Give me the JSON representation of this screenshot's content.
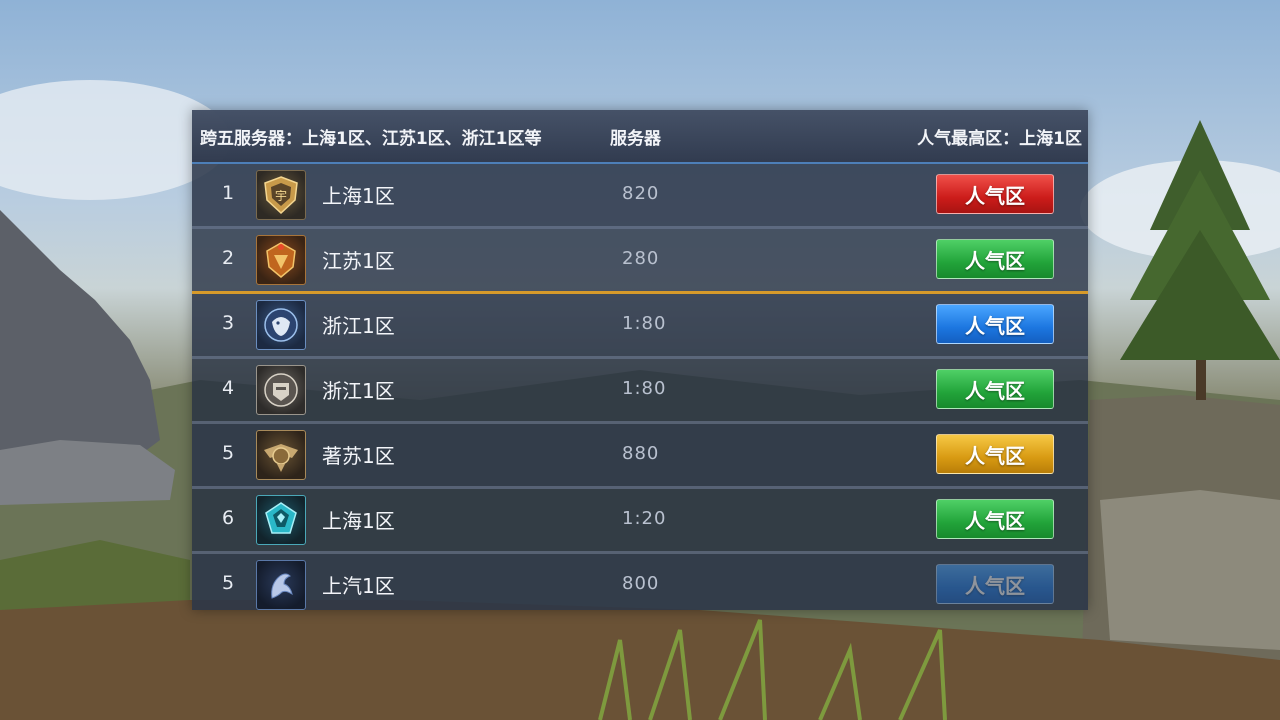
{
  "header": {
    "left": "跨五服务器：上海1区、江苏1区、浙江1区等",
    "middle": "服务器",
    "right": "人气最高区：上海1区"
  },
  "rows": [
    {
      "rank": "1",
      "name": "上海1区",
      "count": "820",
      "button": "人气区",
      "button_color": "#e02a26",
      "emblem": "shield-emblem-icon"
    },
    {
      "rank": "2",
      "name": "江苏1区",
      "count": "280",
      "button": "人气区",
      "button_color": "#22a33a",
      "emblem": "crest-emblem-icon"
    },
    {
      "rank": "3",
      "name": "浙江1区",
      "count": "1:80",
      "button": "人气区",
      "button_color": "#1c76e0",
      "emblem": "wolf-emblem-icon"
    },
    {
      "rank": "4",
      "name": "浙江1区",
      "count": "1:80",
      "button": "人气区",
      "button_color": "#22a33a",
      "emblem": "helmet-emblem-icon"
    },
    {
      "rank": "5",
      "name": "著苏1区",
      "count": "880",
      "button": "人气区",
      "button_color": "#d89a12",
      "emblem": "wings-emblem-icon"
    },
    {
      "rank": "6",
      "name": "上海1区",
      "count": "1:20",
      "button": "人气区",
      "button_color": "#22a33a",
      "emblem": "crystal-emblem-icon"
    },
    {
      "rank": "5",
      "name": "上汽1区",
      "count": "800",
      "button": "人气区",
      "button_color": "#1c76e0",
      "emblem": "dragon-emblem-icon"
    }
  ]
}
